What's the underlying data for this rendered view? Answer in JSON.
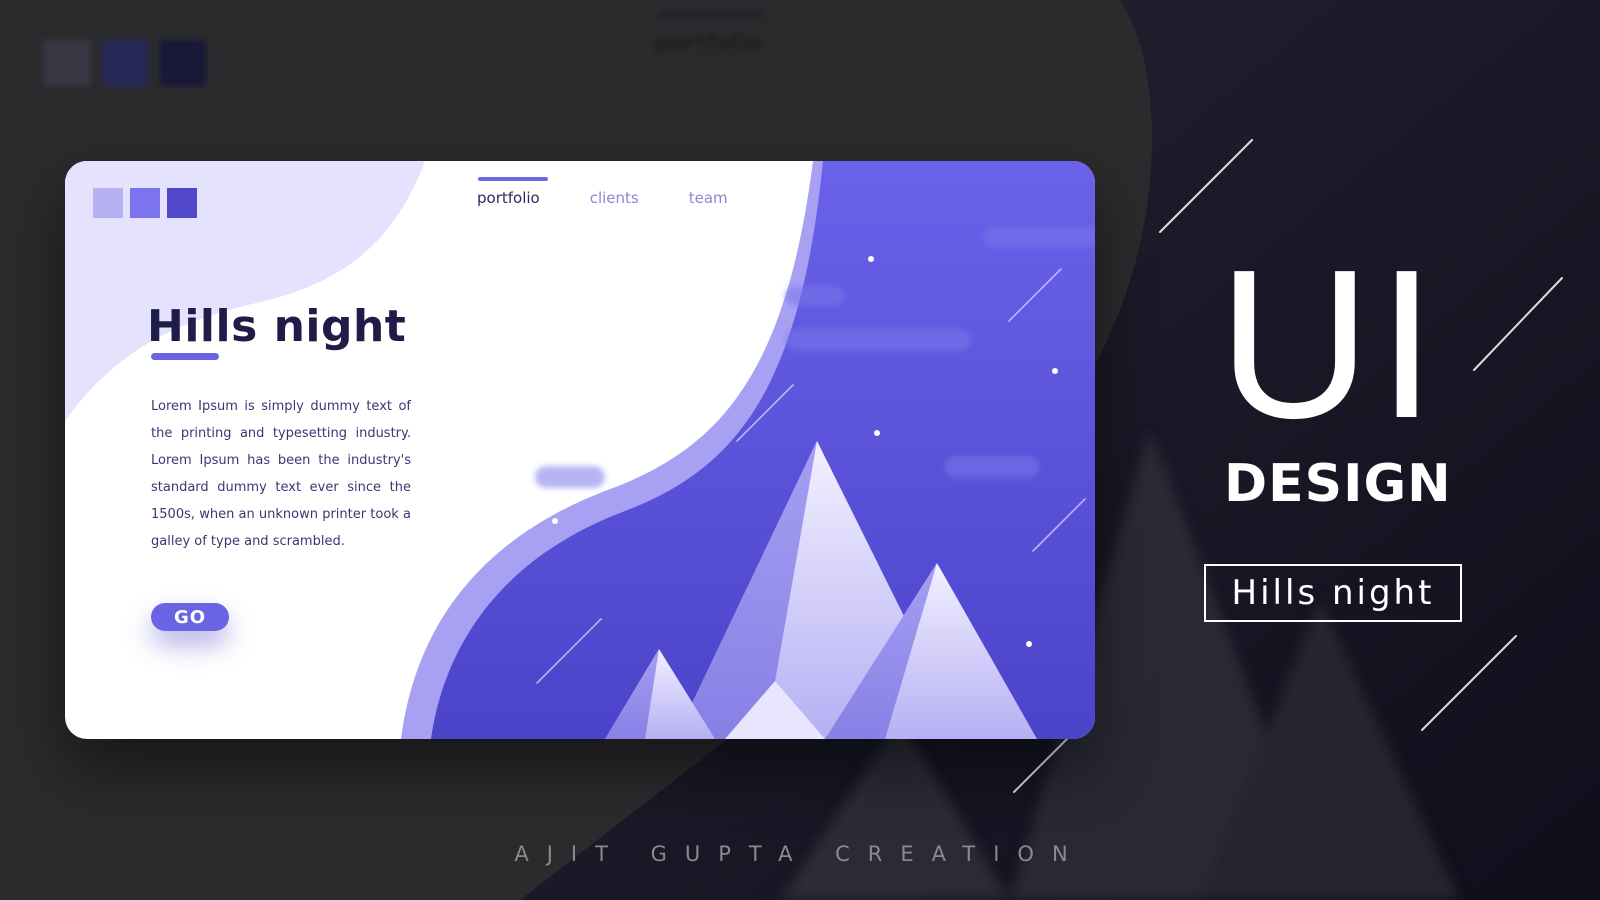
{
  "brand_squares": [
    "#b7b1f2",
    "#7b74ee",
    "#5048c8"
  ],
  "nav": {
    "items": [
      {
        "label": "portfolio",
        "active": true
      },
      {
        "label": "clients",
        "active": false
      },
      {
        "label": "team",
        "active": false
      }
    ]
  },
  "hero": {
    "title": "Hills night",
    "body": "Lorem Ipsum is simply dummy text of the printing and typesetting industry. Lorem Ipsum has been the industry's standard dummy text ever since the 1500s, when an unknown printer took a galley of type and scrambled.",
    "cta_label": "GO"
  },
  "headline": {
    "big": "UI",
    "sub": "DESIGN",
    "tag": "Hills night"
  },
  "credit": "AJIT GUPTA CREATION",
  "colors": {
    "accent": "#6a64e4",
    "night_sky": "#5a52d8",
    "lavender": "#d9d6fb",
    "background": "#2c2c2f"
  }
}
